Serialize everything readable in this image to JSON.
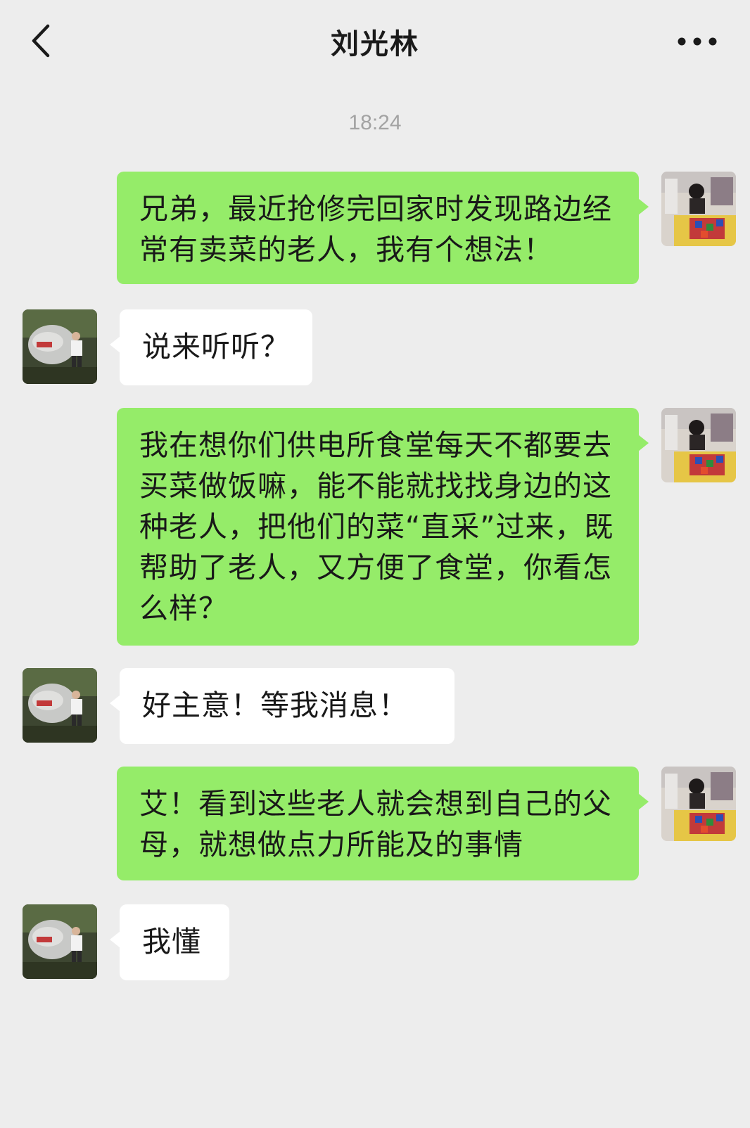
{
  "header": {
    "title": "刘光林",
    "back_icon": "chevron-left-icon",
    "more_icon": "more-dots-icon"
  },
  "timestamp": "18:24",
  "colors": {
    "background": "#ededed",
    "my_bubble": "#95ec69",
    "their_bubble": "#ffffff"
  },
  "messages": [
    {
      "from": "me",
      "text": "兄弟，最近抢修完回家时发现路边经常有卖菜的老人，我有个想法！"
    },
    {
      "from": "them",
      "text": "说来听听？"
    },
    {
      "from": "me",
      "text": "我在想你们供电所食堂每天不都要去买菜做饭嘛，能不能就找找身边的这种老人，把他们的菜“直采”过来，既帮助了老人，又方便了食堂，你看怎么样？"
    },
    {
      "from": "them",
      "text": "好主意！等我消息！"
    },
    {
      "from": "me",
      "text": "艾！看到这些老人就会想到自己的父母，就想做点力所能及的事情"
    },
    {
      "from": "them",
      "text": "我懂"
    }
  ]
}
